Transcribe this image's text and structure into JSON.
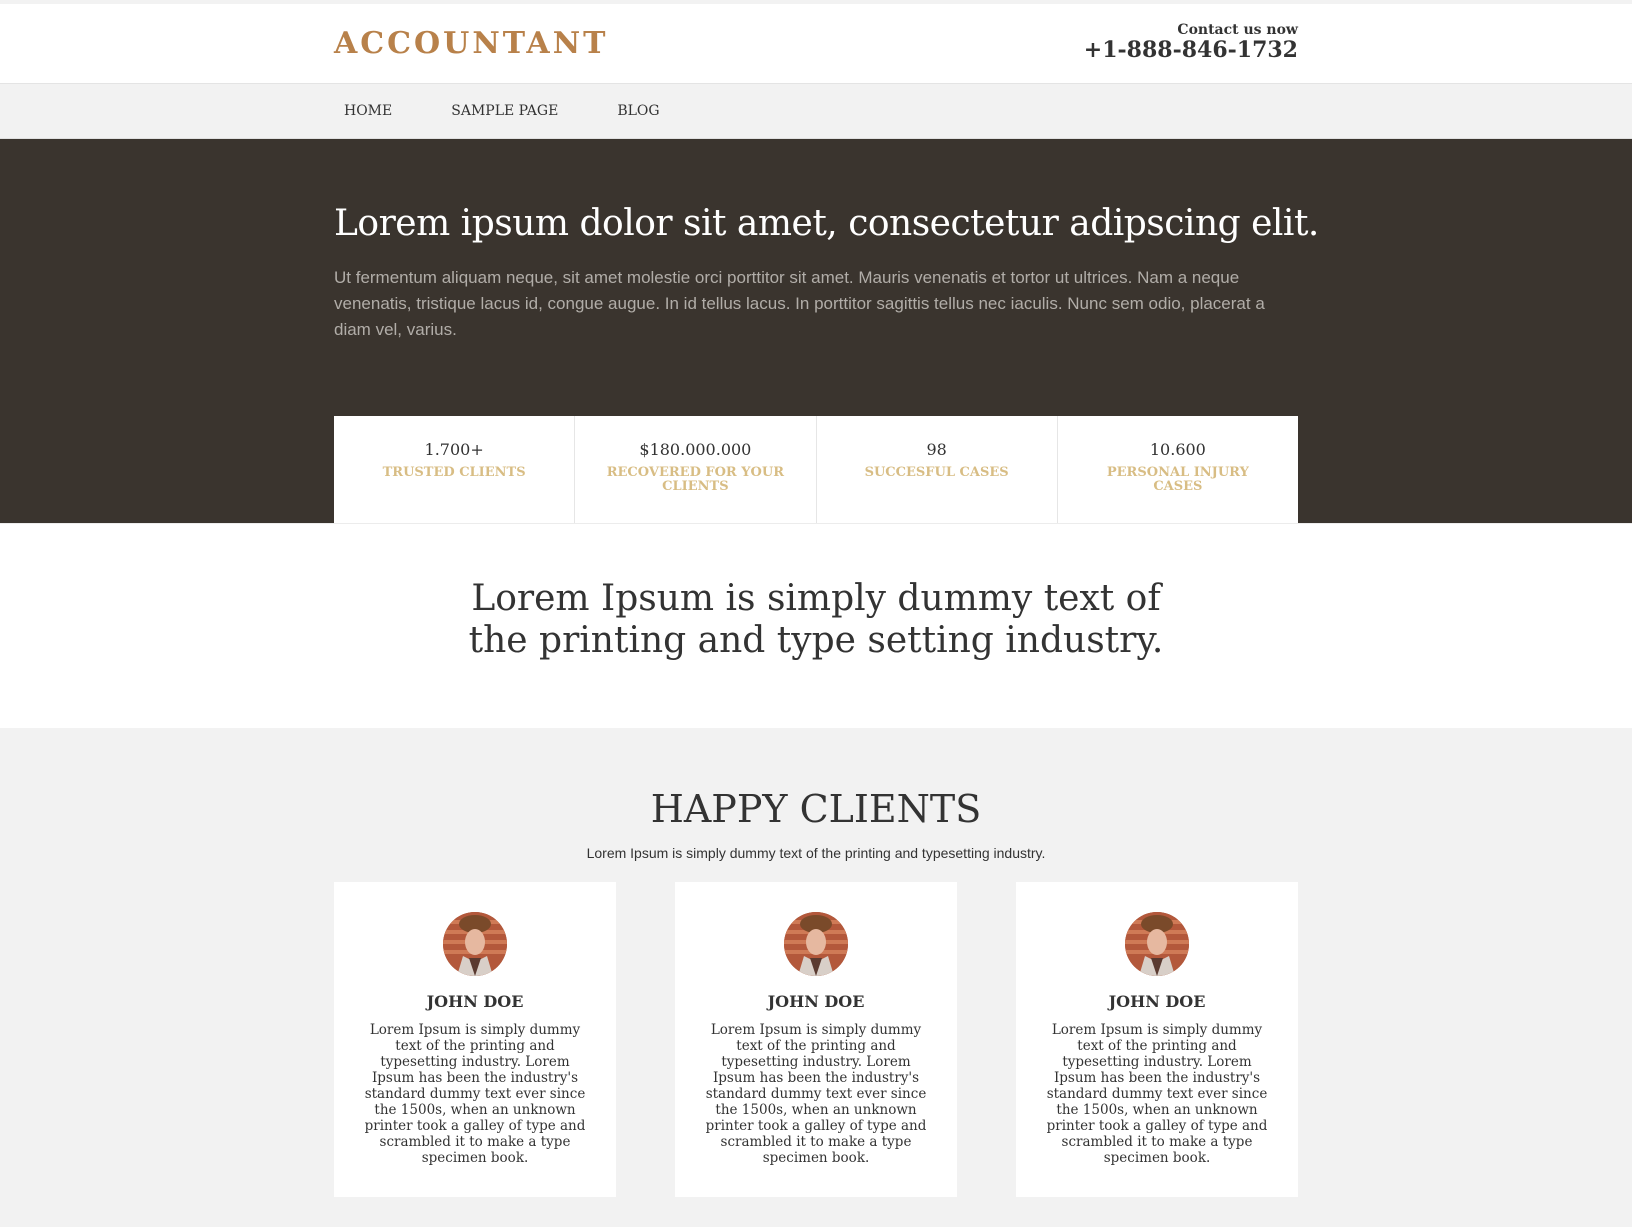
{
  "header": {
    "logo": "ACCOUNTANT",
    "contact_label": "Contact us now",
    "phone": "+1-888-846-1732"
  },
  "nav": {
    "items": [
      {
        "label": "HOME"
      },
      {
        "label": "SAMPLE PAGE"
      },
      {
        "label": "BLOG"
      }
    ]
  },
  "hero": {
    "title": "Lorem ipsum dolor sit amet, consectetur adipscing elit.",
    "text": "Ut fermentum aliquam neque, sit amet molestie orci porttitor sit amet. Mauris venenatis et tortor ut ultrices. Nam a neque venenatis, tristique lacus id, congue augue. In id tellus lacus. In porttitor sagittis tellus nec iaculis. Nunc sem odio, placerat a diam vel, varius."
  },
  "stats": [
    {
      "value": "1.700+",
      "label": "TRUSTED CLIENTS"
    },
    {
      "value": "$180.000.000",
      "label": "RECOVERED FOR YOUR CLIENTS"
    },
    {
      "value": "98",
      "label": "SUCCESFUL CASES"
    },
    {
      "value": "10.600",
      "label": "PERSONAL INJURY CASES"
    }
  ],
  "intro": {
    "line1": "Lorem Ipsum is simply dummy text of",
    "line2": "the printing and type setting industry."
  },
  "testimonials": {
    "title": "HAPPY CLIENTS",
    "subtitle": "Lorem Ipsum is simply dummy text of the printing and typesetting industry.",
    "cards": [
      {
        "name": "JOHN DOE",
        "text": "Lorem Ipsum is simply dummy text of the printing and typesetting industry. Lorem Ipsum has been the industry's standard dummy text ever since the 1500s, when an unknown printer took a galley of type and scrambled it to make a type specimen book."
      },
      {
        "name": "JOHN DOE",
        "text": "Lorem Ipsum is simply dummy text of the printing and typesetting industry. Lorem Ipsum has been the industry's standard dummy text ever since the 1500s, when an unknown printer took a galley of type and scrambled it to make a type specimen book."
      },
      {
        "name": "JOHN DOE",
        "text": "Lorem Ipsum is simply dummy text of the printing and typesetting industry. Lorem Ipsum has been the industry's standard dummy text ever since the 1500s, when an unknown printer took a galley of type and scrambled it to make a type specimen book."
      }
    ]
  },
  "colors": {
    "brand": "#b8814a",
    "hero_bg": "#3a342e",
    "stat_label": "#d8bd84"
  }
}
